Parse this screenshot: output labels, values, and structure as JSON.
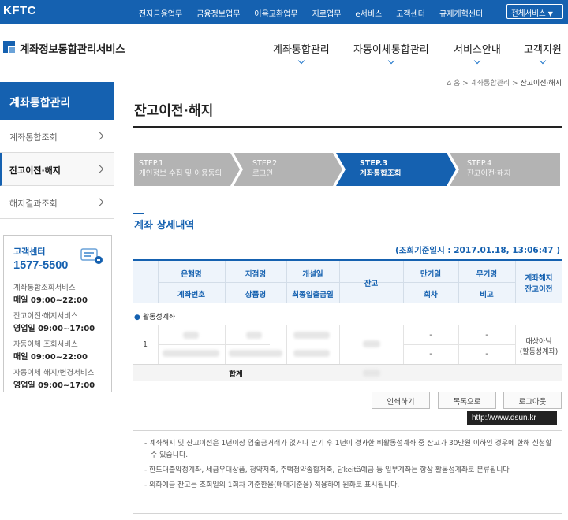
{
  "topbar": {
    "logo": "KFTC",
    "nav": [
      "전자금융업무",
      "금융정보업무",
      "어음교환업무",
      "지로업무",
      "e서비스",
      "고객센터",
      "규제개혁센터"
    ],
    "all_services": "전체서비스",
    "bg_color": "#1561b0"
  },
  "header": {
    "brand": "계좌정보통합관리서비스",
    "gnb": [
      "계좌통합관리",
      "자동이체통합관리",
      "서비스안내",
      "고객지원"
    ]
  },
  "breadcrumb": {
    "home": "홈",
    "items": [
      "계좌통합관리",
      "잔고이전·해지"
    ]
  },
  "sidebar": {
    "title": "계좌통합관리",
    "items": [
      {
        "label": "계좌통합조회",
        "active": false
      },
      {
        "label": "잔고이전·해지",
        "active": true
      },
      {
        "label": "해지결과조회",
        "active": false
      }
    ]
  },
  "customer_center": {
    "title": "고객센터",
    "phone": "1577-5500",
    "hours": [
      {
        "label": "계좌통합조회서비스",
        "time": "매일 09:00~22:00"
      },
      {
        "label": "잔고이전·해지서비스",
        "time": "영업일 09:00~17:00"
      },
      {
        "label": "자동이체 조회서비스",
        "time": "매일 09:00~22:00"
      },
      {
        "label": "자동이체 해지/변경서비스",
        "time": "영업일 09:00~17:00"
      }
    ]
  },
  "page": {
    "title": "잔고이전·해지",
    "steps": [
      {
        "num": "STEP.1",
        "title": "개인정보 수집 및 이용동의",
        "state": "done"
      },
      {
        "num": "STEP.2",
        "title": "로그인",
        "state": "done"
      },
      {
        "num": "STEP.3",
        "title": "계좌통합조회",
        "state": "current"
      },
      {
        "num": "STEP.4",
        "title": "잔고이전·해지",
        "state": "todo"
      }
    ],
    "section_title": "계좌 상세내역",
    "ref_date": "(조회기준일시 : 2017.01.18, 13:06:47 )"
  },
  "table": {
    "headers": {
      "bank": "은행명",
      "branch": "지점명",
      "open_date": "개설일",
      "account_no": "계좌번호",
      "product": "상품명",
      "last_tx": "최종입출금일",
      "balance": "잔고",
      "maturity": "만기일",
      "installment": "회차",
      "rate": "무기명",
      "note": "비고",
      "action": "계좌해지 잔고이전",
      "action_line1": "계좌해지",
      "action_line2": "잔고이전"
    },
    "group": "활동성계좌",
    "rows": [
      {
        "no": "1",
        "maturity": "-",
        "installment": "-",
        "rate": "-",
        "note": "-",
        "status_line1": "대상아님",
        "status_line2": "(활동성계좌)"
      }
    ],
    "total_label": "합계"
  },
  "buttons": {
    "print": "인쇄하기",
    "list": "목록으로",
    "logout": "로그아웃"
  },
  "watermark": "http://www.dsun.kr",
  "notices": [
    "- 계좌해지 및 잔고이전은 1년이상 입출금거래가 없거나 만기 후 1년이 경과한 비활동성계좌 중 잔고가 30만원 이하인 경우에 한해 신청할 수 있습니다.",
    "- 한도대출약정계좌, 세금우대상품, 청약저축, 주택청약종합저축, 담keitä예금 등 일부계좌는 항상 활동성계좌로 분류됩니다",
    "- 외화예금 잔고는 조회일의 1회차 기준환율(매매기준율) 적용하여 원화로 표시됩니다."
  ]
}
